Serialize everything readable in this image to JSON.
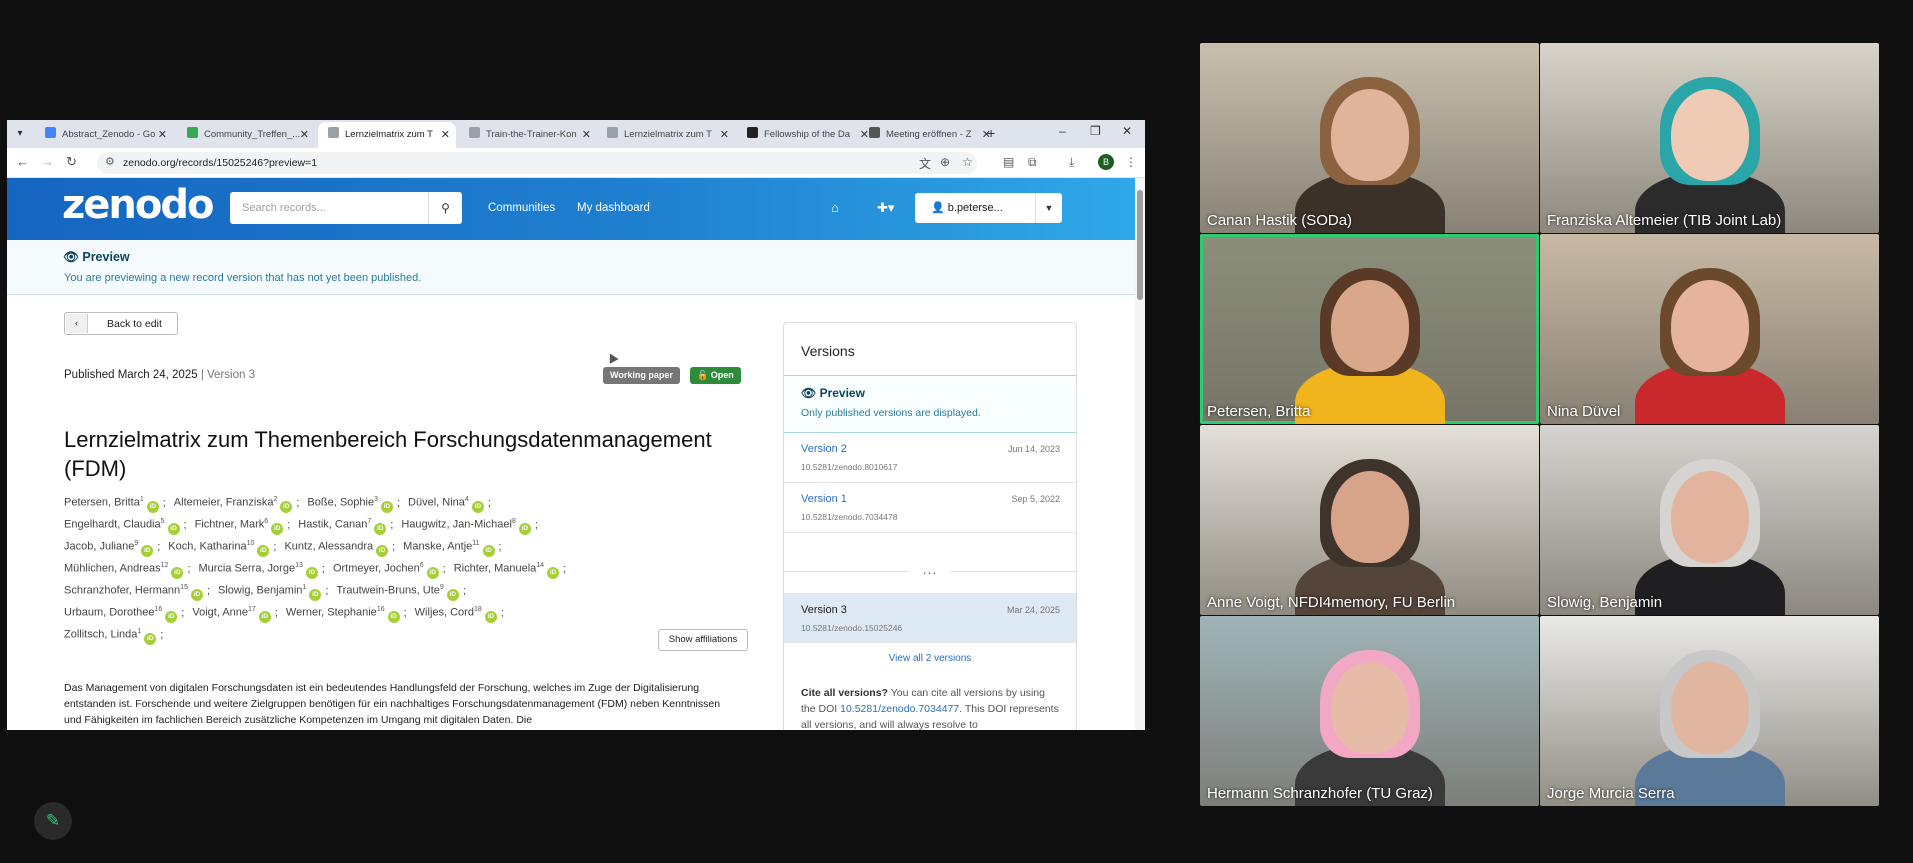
{
  "browser": {
    "tabs": [
      {
        "label": "Abstract_Zenodo - Go",
        "color": "#4285f4"
      },
      {
        "label": "Community_Treffen_...",
        "color": "#34a853"
      },
      {
        "label": "Lernzielmatrix zum T",
        "color": "#9aa0a6"
      },
      {
        "label": "Train-the-Trainer-Kon",
        "color": "#9aa0a6"
      },
      {
        "label": "Lernzielmatrix zum T",
        "color": "#9aa0a6"
      },
      {
        "label": "Fellowship of the Da",
        "color": "#222222"
      },
      {
        "label": "Meeting eröffnen - Z",
        "color": "#555555"
      }
    ],
    "new_tab": "+",
    "url": "zenodo.org/records/15025246?preview=1",
    "profile_initial": "B"
  },
  "zenodo": {
    "logo": "zenodo",
    "search_placeholder": "Search records...",
    "nav": {
      "communities": "Communities",
      "dashboard": "My dashboard"
    },
    "user": "b.peterse...",
    "preview_heading": "Preview",
    "preview_text": "You are previewing a new record version that has not yet been published.",
    "back_button": "Back to edit",
    "published": "Published March 24, 2025",
    "version_label": "| Version 3",
    "badge_type": "Working paper",
    "badge_open": "Open",
    "title": "Lernzielmatrix zum Themenbereich Forschungsdatenmanagement (FDM)",
    "author_rows": [
      [
        [
          "Petersen, Britta",
          "1"
        ],
        [
          "Altemeier, Franziska",
          "2"
        ],
        [
          "Boße, Sophie",
          "3"
        ],
        [
          "Düvel, Nina",
          "4"
        ]
      ],
      [
        [
          "Engelhardt, Claudia",
          "5"
        ],
        [
          "Fichtner, Mark",
          "6"
        ],
        [
          "Hastik, Canan",
          "7"
        ],
        [
          "Haugwitz, Jan-Michael",
          "8"
        ]
      ],
      [
        [
          "Jacob, Juliane",
          "9"
        ],
        [
          "Koch, Katharina",
          "10"
        ],
        [
          "Kuntz, Alessandra",
          ""
        ],
        [
          "Manske, Antje",
          "11"
        ]
      ],
      [
        [
          "Mühlichen, Andreas",
          "12"
        ],
        [
          "Murcia Serra, Jorge",
          "13"
        ],
        [
          "Ortmeyer, Jochen",
          "6"
        ],
        [
          "Richter, Manuela",
          "14"
        ]
      ],
      [
        [
          "Schranzhofer, Hermann",
          "15"
        ],
        [
          "Slowig, Benjamin",
          "1"
        ],
        [
          "Trautwein-Bruns, Ute",
          "9"
        ]
      ],
      [
        [
          "Urbaum, Dorothee",
          "16"
        ],
        [
          "Voigt, Anne",
          "17"
        ],
        [
          "Werner, Stephanie",
          "16"
        ],
        [
          "Wiljes, Cord",
          "18"
        ]
      ],
      [
        [
          "Zollitsch, Linda",
          "1"
        ]
      ]
    ],
    "affiliations_button": "Show affiliations",
    "abstract": "Das Management von digitalen Forschungsdaten ist ein bedeutendes Handlungsfeld der Forschung, welches im Zuge der Digitalisierung entstanden ist. Forschende und weitere Zielgruppen benötigen für ein nachhaltiges Forschungsdatenmanagement (FDM) neben Kenntnissen und Fähigkeiten im fachlichen Bereich zusätzliche Kompetenzen im Umgang mit digitalen Daten. Die",
    "versions": {
      "heading": "Versions",
      "preview_title": "Preview",
      "preview_text": "Only published versions are displayed.",
      "items": [
        {
          "name": "Version 2",
          "date": "Jun 14, 2023",
          "doi": "10.5281/zenodo.8010617"
        },
        {
          "name": "Version 1",
          "date": "Sep 5, 2022",
          "doi": "10.5281/zenodo.7034478"
        }
      ],
      "more": "...",
      "current": {
        "name": "Version 3",
        "date": "Mar 24, 2025",
        "doi": "10.5281/zenodo.15025246"
      },
      "view_all": "View all 2 versions",
      "cite_label": "Cite all versions?",
      "cite_text_1": "You can cite all versions by using the DOI",
      "cite_doi": "10.5281/zenodo.7034477",
      "cite_text_2": ". This DOI represents all versions, and will always resolve to"
    }
  },
  "participants": [
    {
      "name": "Canan Hastik (SODa)",
      "bg": "#c9bfae",
      "skin": "#e0b49a",
      "hair": "#8a6240",
      "shirt": "#3b3128"
    },
    {
      "name": "Franziska Altemeier (TIB Joint Lab)",
      "bg": "#d9d4c9",
      "skin": "#efcab4",
      "hair": "#2aa5a8",
      "shirt": "#2b2b2b"
    },
    {
      "name": "Petersen, Britta",
      "bg": "#8b8f7a",
      "skin": "#d9a88b",
      "hair": "#5a3a26",
      "shirt": "#f0b41d"
    },
    {
      "name": "Nina Düvel",
      "bg": "#c8b9a6",
      "skin": "#e6b49c",
      "hair": "#6b4a2c",
      "shirt": "#c9282d"
    },
    {
      "name": "Anne Voigt, NFDI4memory, FU Berlin",
      "bg": "#e4e0d8",
      "skin": "#d7a48a",
      "hair": "#3e342c",
      "shirt": "#55443a"
    },
    {
      "name": "Slowig, Benjamin",
      "bg": "#d6d4d0",
      "skin": "#e3b49d",
      "hair": "#d6d4d0",
      "shirt": "#1f1f22"
    },
    {
      "name": "Hermann Schranzhofer (TU Graz)",
      "bg": "#9fb4b8",
      "skin": "#e6bca8",
      "hair": "#f2a8c4",
      "shirt": "#3a3a3a"
    },
    {
      "name": "Jorge Murcia Serra",
      "bg": "#e9e9e6",
      "skin": "#e0b6a0",
      "hair": "#c8c8c8",
      "shirt": "#5b7a9a"
    }
  ],
  "colors": {
    "speaking": "#2ecc71",
    "zenodo_blue": "#1565c0",
    "orcid": "#a6ce39"
  }
}
